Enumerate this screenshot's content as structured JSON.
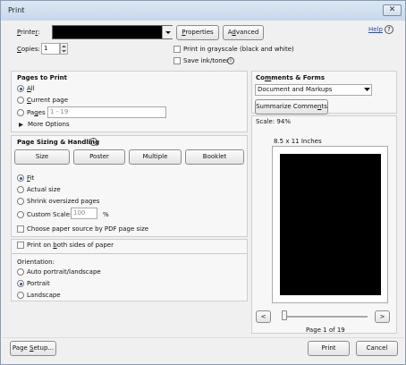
{
  "window": {
    "title": "Print",
    "close_glyph": "✕"
  },
  "printer": {
    "label": "Printer:",
    "value": "",
    "properties_label": "Properties",
    "advanced_label": "Advanced",
    "help_label": "Help",
    "copies_label": "Copies:",
    "copies_value": "1",
    "grayscale_label": "Print in grayscale (black and white)",
    "save_ink_label": "Save ink/toner"
  },
  "pages_to_print": {
    "heading": "Pages to Print",
    "all_label": "All",
    "current_label": "Current page",
    "pages_label": "Pages",
    "pages_value": "1 - 19",
    "more_options_label": "More Options",
    "selected": "All"
  },
  "sizing": {
    "heading": "Page Sizing & Handling",
    "tabs": [
      "Size",
      "Poster",
      "Multiple",
      "Booklet"
    ],
    "fit_label": "Fit",
    "actual_label": "Actual size",
    "shrink_label": "Shrink oversized pages",
    "custom_label": "Custom Scale:",
    "custom_value": "100",
    "percent": "%",
    "pdf_source_label": "Choose paper source by PDF page size",
    "selected": "Fit"
  },
  "both_sides_label": "Print on both sides of paper",
  "orientation": {
    "label": "Orientation:",
    "auto_label": "Auto portrait/landscape",
    "portrait_label": "Portrait",
    "landscape_label": "Landscape",
    "selected": "Portrait"
  },
  "comments": {
    "heading": "Comments & Forms",
    "value": "Document and Markups",
    "summarize_label": "Summarize Comments"
  },
  "preview": {
    "scale_label": "Scale: 94%",
    "paper_label": "8.5 x 11 Inches",
    "prev_glyph": "<",
    "next_glyph": ">",
    "page_label": "Page 1 of 19"
  },
  "footer": {
    "page_setup_label": "Page Setup...",
    "print_label": "Print",
    "cancel_label": "Cancel"
  }
}
